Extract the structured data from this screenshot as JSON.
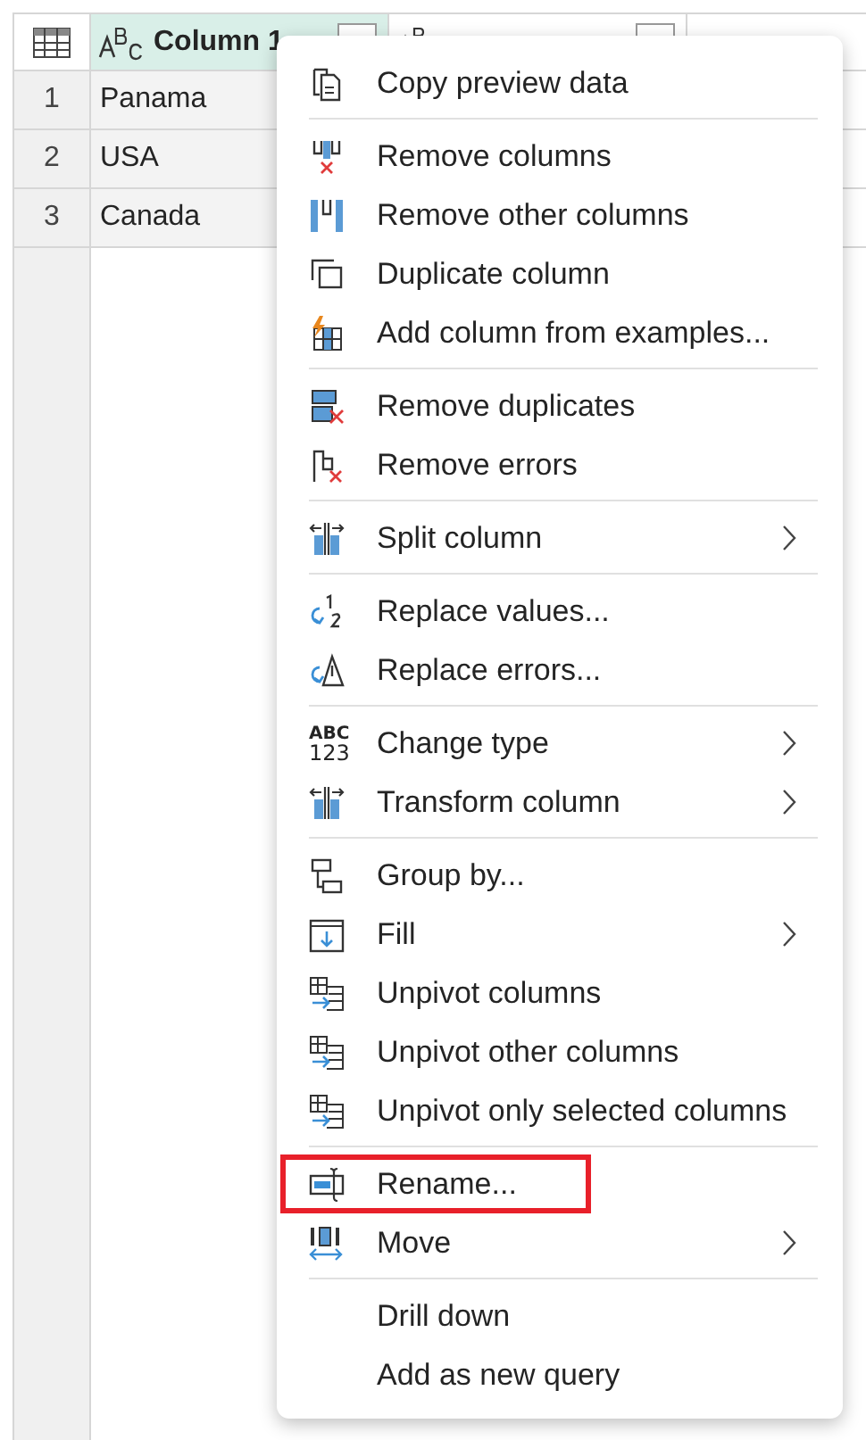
{
  "table": {
    "columns": [
      {
        "label": "Column 1",
        "selected": true
      },
      {
        "selected": false
      }
    ],
    "rows": [
      {
        "number": "1",
        "cells": [
          "Panama"
        ]
      },
      {
        "number": "2",
        "cells": [
          "USA"
        ]
      },
      {
        "number": "3",
        "cells": [
          "Canada"
        ]
      }
    ]
  },
  "context_menu": {
    "sections": [
      [
        {
          "label": "Copy preview data",
          "submenu": false,
          "highlighted": false
        }
      ],
      [
        {
          "label": "Remove columns",
          "submenu": false,
          "highlighted": false
        },
        {
          "label": "Remove other columns",
          "submenu": false,
          "highlighted": false
        },
        {
          "label": "Duplicate column",
          "submenu": false,
          "highlighted": false
        },
        {
          "label": "Add column from examples...",
          "submenu": false,
          "highlighted": false
        }
      ],
      [
        {
          "label": "Remove duplicates",
          "submenu": false,
          "highlighted": false
        },
        {
          "label": "Remove errors",
          "submenu": false,
          "highlighted": false
        }
      ],
      [
        {
          "label": "Split column",
          "submenu": true,
          "highlighted": false
        }
      ],
      [
        {
          "label": "Replace values...",
          "submenu": false,
          "highlighted": false
        },
        {
          "label": "Replace errors...",
          "submenu": false,
          "highlighted": false
        }
      ],
      [
        {
          "label": "Change type",
          "submenu": true,
          "highlighted": false,
          "icon_text": [
            "ABC",
            "123"
          ]
        },
        {
          "label": "Transform column",
          "submenu": true,
          "highlighted": false
        }
      ],
      [
        {
          "label": "Group by...",
          "submenu": false,
          "highlighted": false
        },
        {
          "label": "Fill",
          "submenu": true,
          "highlighted": false
        },
        {
          "label": "Unpivot columns",
          "submenu": false,
          "highlighted": false
        },
        {
          "label": "Unpivot other columns",
          "submenu": false,
          "highlighted": false
        },
        {
          "label": "Unpivot only selected columns",
          "submenu": false,
          "highlighted": false
        }
      ],
      [
        {
          "label": "Rename...",
          "submenu": false,
          "highlighted": true
        },
        {
          "label": "Move",
          "submenu": true,
          "highlighted": false
        }
      ],
      [
        {
          "label": "Drill down",
          "submenu": false,
          "highlighted": false
        },
        {
          "label": "Add as new query",
          "submenu": false,
          "highlighted": false
        }
      ]
    ]
  }
}
